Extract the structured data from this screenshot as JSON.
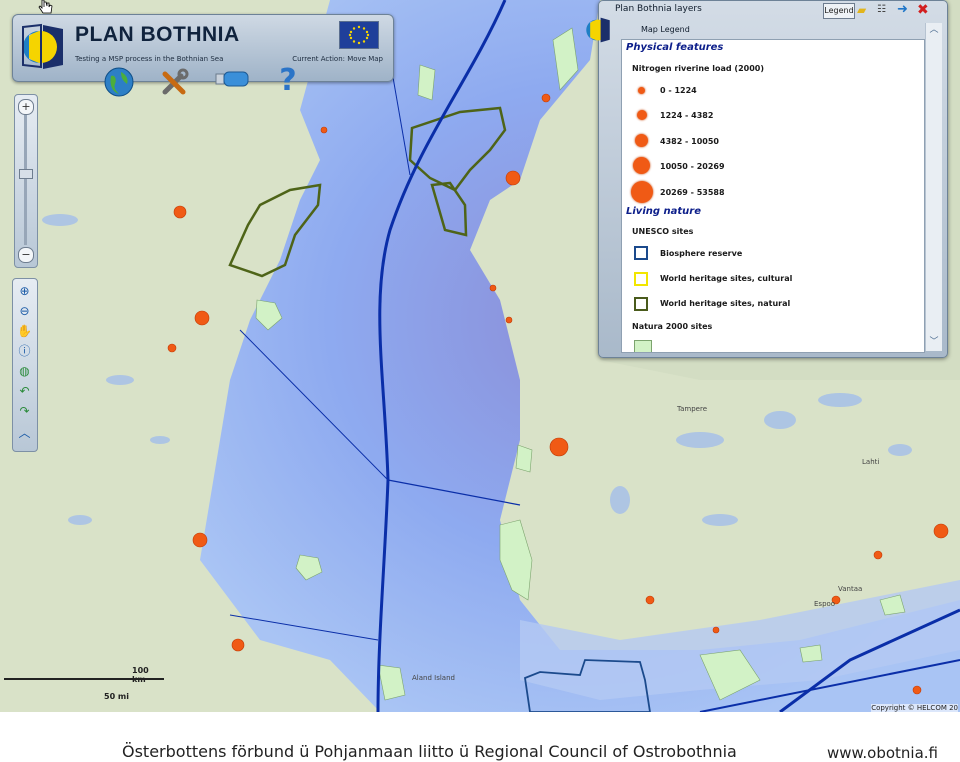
{
  "app": {
    "title": "PLAN BOTHNIA",
    "subtitle": "Testing a MSP process in the Bothnian Sea",
    "current_action": "Current Action: Move Map"
  },
  "toolbar": {
    "icons": [
      "globe-icon",
      "tools-icon",
      "usb-stick-icon",
      "help-icon"
    ]
  },
  "map_controls": {
    "zoom_in": "+",
    "zoom_out": "−",
    "tools": [
      "zoom-in-box-icon",
      "zoom-out-box-icon",
      "pan-hand-icon",
      "info-icon",
      "globe-small-icon",
      "undo-icon",
      "redo-icon",
      "collapse-icon"
    ]
  },
  "layers_panel": {
    "title": "Plan Bothnia layers",
    "legend_button": "Legend",
    "map_legend_label": "Map Legend",
    "sections": [
      {
        "title": "Physical features",
        "subtitle": "Nitrogen riverine load (2000)",
        "items": [
          "0 - 1224",
          "1224 - 4382",
          "4382 - 10050",
          "10050 - 20269",
          "20269 - 53588"
        ]
      },
      {
        "title": "Living nature",
        "subtitle": "UNESCO sites",
        "items": [
          "Biosphere reserve",
          "World heritage sites, cultural",
          "World heritage sites, natural"
        ],
        "colors": [
          "#1b4a8c",
          "#f2e600",
          "#4a5b1c"
        ]
      }
    ],
    "natura_label": "Natura 2000 sites"
  },
  "map": {
    "scale_km": "100 km",
    "scale_mi": "50 mi",
    "copyright": "Copyright © HELCOM 20",
    "place_labels": [
      "Tampere",
      "Lahti",
      "Vantaa",
      "Espoo",
      "Aland Island"
    ],
    "colors": {
      "sea": "#8aa8e8",
      "land": "#d9e2c8",
      "nitrogen_dot": "#f05a15",
      "natura": "#d2f2c6"
    }
  },
  "footer": {
    "text": "Österbottens förbund ü   Pohjanmaan liitto ü   Regional Council of Ostrobothnia",
    "url": "www.obotnia.fi"
  }
}
